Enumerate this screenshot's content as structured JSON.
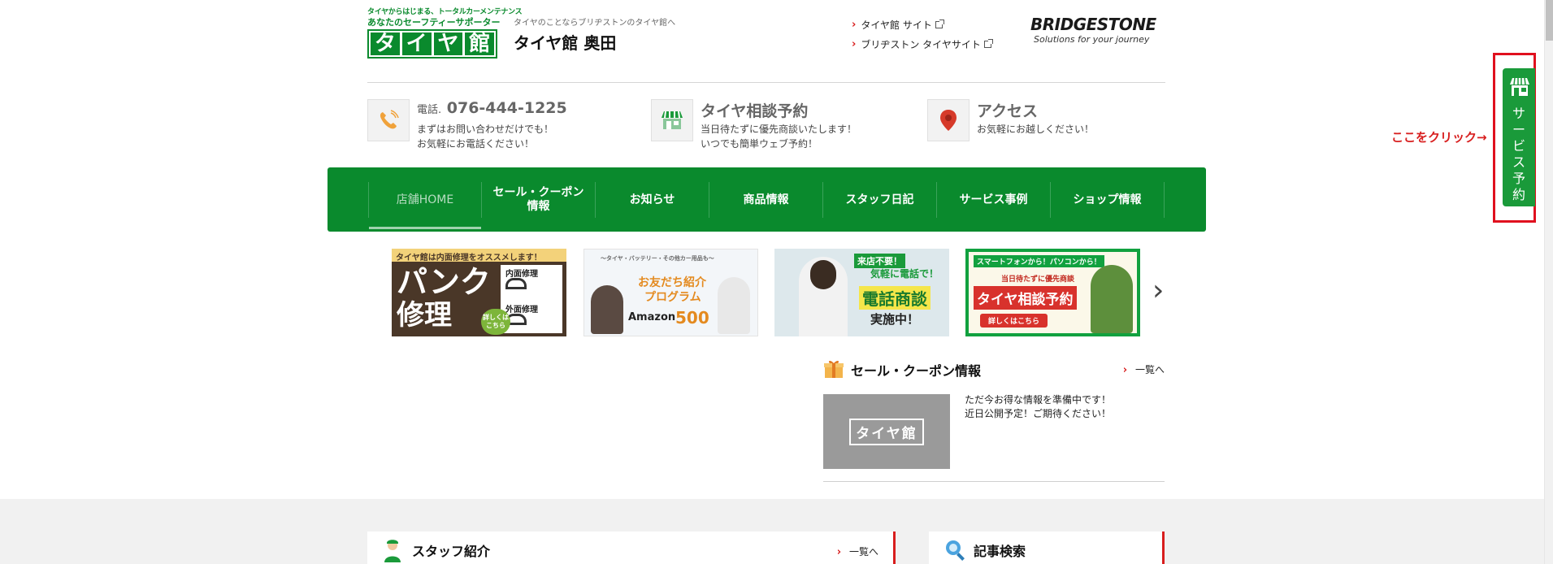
{
  "header": {
    "logo_tagline1": "タイヤからはじまる、トータルカーメンテナンス",
    "logo_tagline2": "あなたのセーフティーサポーター",
    "logo_chars": [
      "タ",
      "イ",
      "ヤ",
      "館"
    ],
    "store_sub": "タイヤのことならブリヂストンのタイヤ館へ",
    "store_name": "タイヤ館 奥田",
    "links": [
      "タイヤ館 サイト",
      "ブリヂストン タイヤサイト"
    ],
    "brand": "BRIDGESTONE",
    "brand_slogan": "Solutions for your journey"
  },
  "info": {
    "phone_prefix": "電話.",
    "phone": "076-444-1225",
    "phone_desc1": "まずはお問い合わせだけでも！",
    "phone_desc2": "お気軽にお電話ください！",
    "reserve_title": "タイヤ相談予約",
    "reserve_desc1": "当日待たずに優先商談いたします！",
    "reserve_desc2": "いつでも簡単ウェブ予約！",
    "access_title": "アクセス",
    "access_desc": "お気軽にお越しください！"
  },
  "nav": {
    "items": [
      "店舗HOME",
      "セール・クーポン\n情報",
      "お知らせ",
      "商品情報",
      "スタッフ日記",
      "サービス事例",
      "ショップ情報"
    ]
  },
  "banners": {
    "b1_top": "タイヤ館は内面修理をオススメします！",
    "b1_big1": "パンク",
    "b1_big2": "修理",
    "b1_side1": "内面修理",
    "b1_side2": "外面修理",
    "b1_btn": "詳しくは\nこちら",
    "b2_top": "〜タイヤ・バッテリー・その他カー用品も〜",
    "b2_title1": "お友だち紹介",
    "b2_title2": "プログラム",
    "b2_amazon": "Amazon",
    "b2_amount": "500",
    "b3_tag": "来店不要！",
    "b3_line": "気軽に電話で！",
    "b3_title": "電話商談",
    "b3_sub": "実施中！",
    "b4_top": "スマートフォンから！パソコンから！",
    "b4_line": "当日待たずに優先商談",
    "b4_title": "タイヤ相談予約",
    "b4_btn": "詳しくはこちら"
  },
  "sale": {
    "title": "セール・クーポン情報",
    "more": "一覧へ",
    "thumb_text": "タイヤ館",
    "msg1": "ただ今お得な情報を準備中です！",
    "msg2": "近日公開予定！ご期待ください！"
  },
  "bottom": {
    "staff_title": "スタッフ紹介",
    "staff_more": "一覧へ",
    "search_title": "記事検索"
  },
  "side": {
    "note": "ここをクリック→",
    "tab_label": "サービス予約"
  },
  "colors": {
    "brand_green": "#0a8a2d",
    "accent_red": "#d81e1e"
  }
}
